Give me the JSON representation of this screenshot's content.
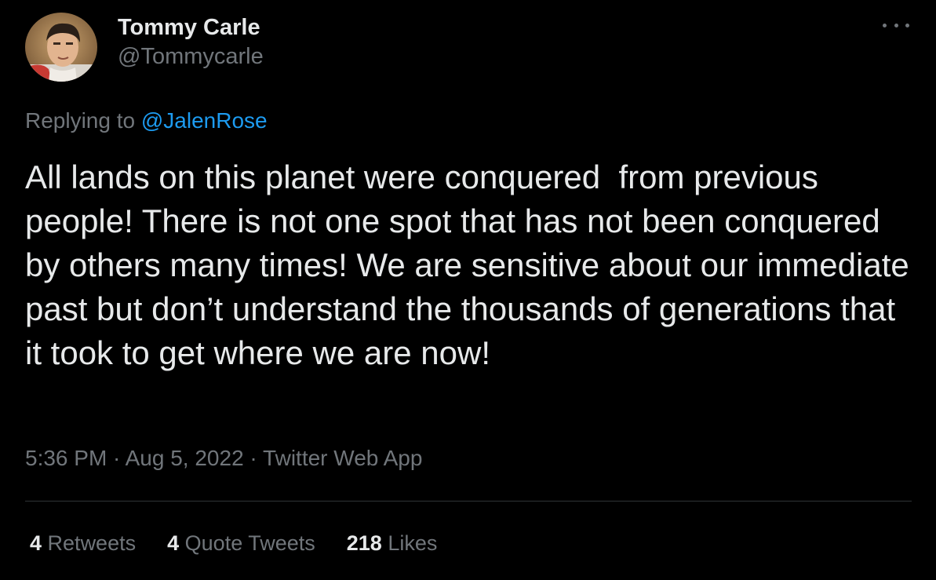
{
  "author": {
    "display_name": "Tommy Carle",
    "handle": "@Tommycarle",
    "avatar_icon": "profile-photo"
  },
  "more_icon": "more-options-icon",
  "reply": {
    "prefix": "Replying to ",
    "to_handle": "@JalenRose"
  },
  "tweet": {
    "text": "All lands on this planet were conquered  from previous people! There is not one spot that has not been conquered by others many times! We are sensitive about our immediate past but don’t understand the thousands of generations that it took to get where we are now!"
  },
  "meta": {
    "time": "5:36 PM",
    "sep1": " · ",
    "date": "Aug 5, 2022",
    "sep2": " · ",
    "source": "Twitter Web App"
  },
  "stats": {
    "retweets_count": "4",
    "retweets_label": "Retweets",
    "quotes_count": "4",
    "quotes_label": "Quote Tweets",
    "likes_count": "218",
    "likes_label": "Likes"
  },
  "colors": {
    "background": "#000000",
    "text": "#e7e9ea",
    "secondary": "#71767b",
    "link": "#1d9bf0",
    "divider": "#2f3336"
  }
}
